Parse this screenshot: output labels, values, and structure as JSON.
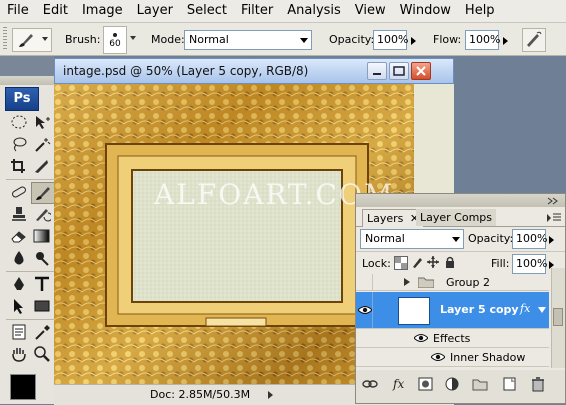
{
  "menubar": {
    "items": [
      "File",
      "Edit",
      "Image",
      "Layer",
      "Select",
      "Filter",
      "Analysis",
      "View",
      "Window",
      "Help"
    ]
  },
  "options": {
    "brush_label": "Brush:",
    "brush_size": "60",
    "mode_label": "Mode:",
    "mode_value": "Normal",
    "opacity_label": "Opacity:",
    "opacity_value": "100%",
    "flow_label": "Flow:",
    "flow_value": "100%"
  },
  "toolbox": {
    "logo": "Ps"
  },
  "document": {
    "title": "intage.psd @ 50% (Layer 5 copy, RGB/8)",
    "watermark": "ALFOART.COM",
    "status": "Doc: 2.85M/50.3M"
  },
  "layers_panel": {
    "tabs": [
      "Layers",
      "Layer Comps"
    ],
    "blend_mode": "Normal",
    "opacity_label": "Opacity:",
    "opacity_value": "100%",
    "lock_label": "Lock:",
    "fill_label": "Fill:",
    "fill_value": "100%",
    "layers": [
      {
        "name": "Group 2"
      },
      {
        "name": "Layer 5 copy",
        "fx": "fx"
      },
      {
        "name": "Effects"
      },
      {
        "name": "Inner Shadow"
      }
    ]
  },
  "colors": {
    "accent_selected_layer": "#3d8ee6",
    "frame_gold": "#c9962e",
    "canvas_linen": "#e4e6d2"
  }
}
